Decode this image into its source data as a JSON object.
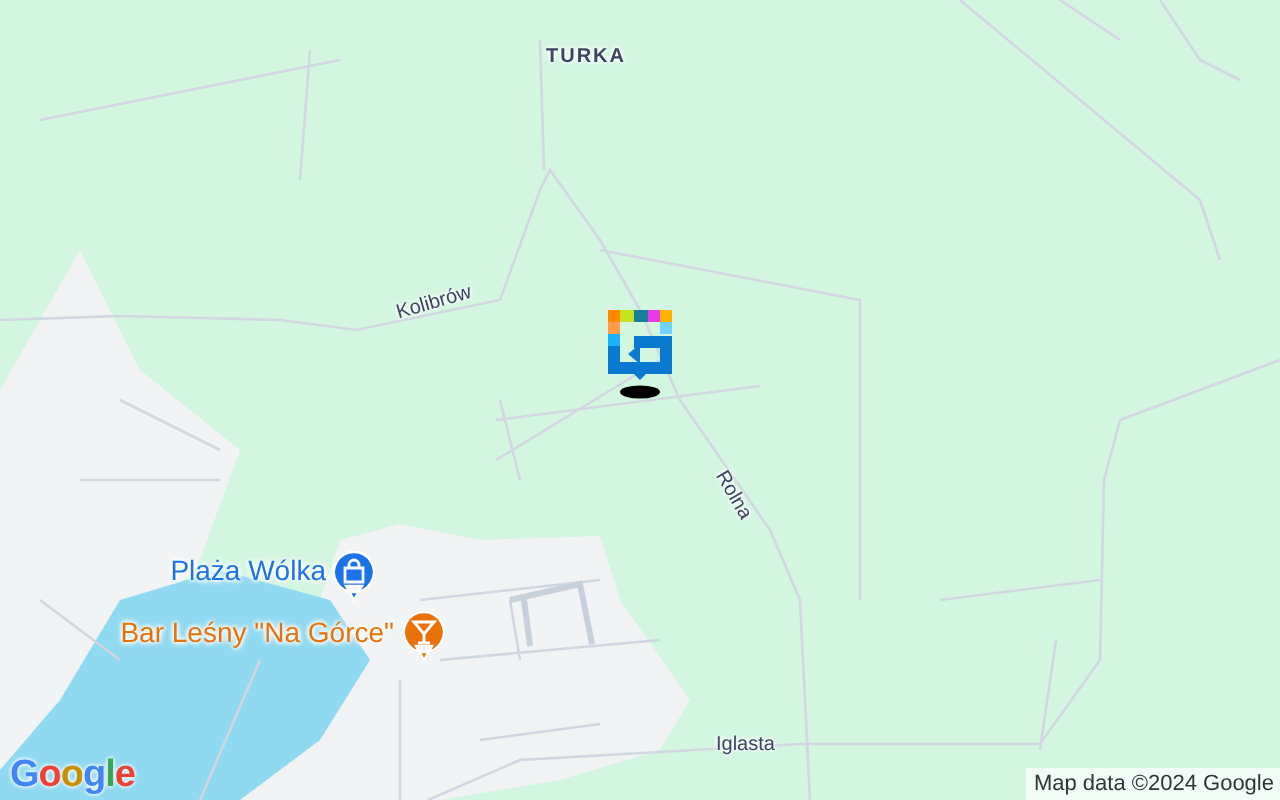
{
  "map": {
    "place_labels": [
      {
        "text": "TURKA"
      }
    ],
    "streets": [
      {
        "name": "Kolibrów"
      },
      {
        "name": "Rolna"
      },
      {
        "name": "Iglasta"
      }
    ],
    "pois": [
      {
        "name": "Plaża Wólka",
        "kind": "shopping",
        "color": "#1a73e8"
      },
      {
        "name": "Bar Leśny \"Na Górce\"",
        "kind": "bar",
        "color": "#e8710a"
      }
    ],
    "logo": "Google",
    "attribution": "Map data ©2024 Google"
  }
}
